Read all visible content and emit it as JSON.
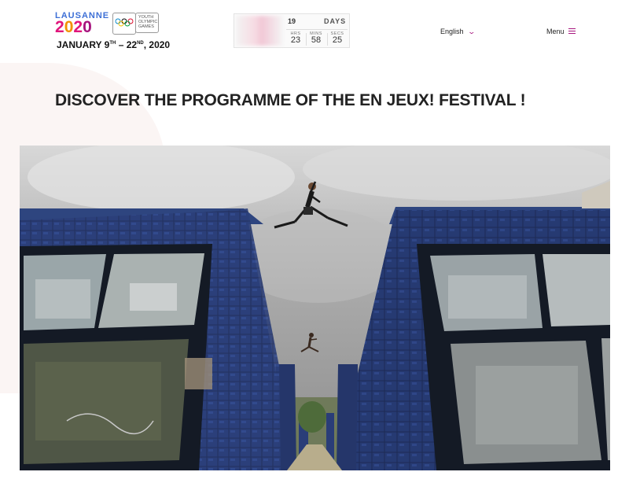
{
  "header": {
    "logo": {
      "word": "LAUSANNE",
      "year_digits": [
        "2",
        "0",
        "2",
        "0"
      ],
      "year_colors": [
        "#e0167c",
        "#f39200",
        "#e0167c",
        "#a7157e"
      ],
      "tagline_lines": [
        "YOUTH",
        "OLYMPIC",
        "GAMES"
      ],
      "dates": {
        "start_prefix": "JANUARY 9",
        "start_suffix": "TH",
        "separator": " – 22",
        "end_suffix": "ND",
        "year": ", 2020"
      }
    },
    "countdown": {
      "days_value": "19",
      "days_label": "DAYS",
      "units": [
        {
          "label": "HRS",
          "value": "23"
        },
        {
          "label": "MINS",
          "value": "58"
        },
        {
          "label": "SECS",
          "value": "25"
        }
      ]
    },
    "language": {
      "label": "English",
      "icon": "chevron-down-icon"
    },
    "menu": {
      "label": "Menu",
      "icon": "hamburger-icon"
    }
  },
  "main": {
    "title": "DISCOVER THE PROGRAMME OF THE EN JEUX! FESTIVAL !",
    "hero_image": {
      "description_icon": "parkour-photo"
    }
  },
  "colors": {
    "brand_magenta": "#a7157e",
    "brand_pink": "#e0167c",
    "brand_orange": "#f39200",
    "brand_blue": "#3d6fd6",
    "accent_bg": "#fbf5f4"
  }
}
